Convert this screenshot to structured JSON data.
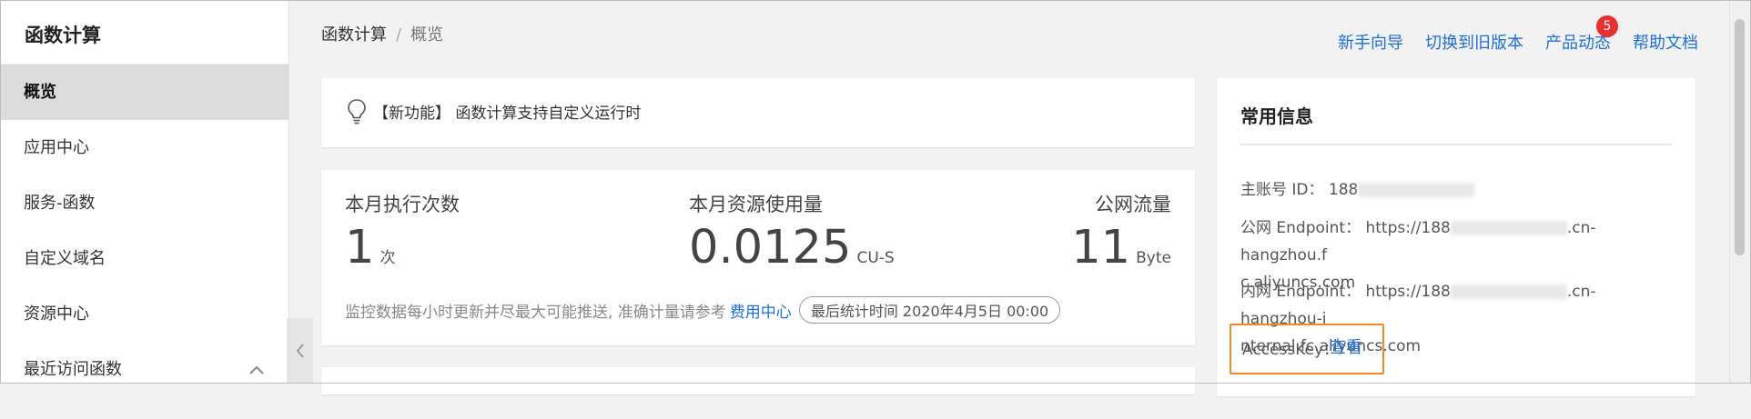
{
  "app_title": "函数计算",
  "sidebar": {
    "items": [
      {
        "label": "概览"
      },
      {
        "label": "应用中心"
      },
      {
        "label": "服务-函数"
      },
      {
        "label": "自定义域名"
      },
      {
        "label": "资源中心"
      },
      {
        "label": "最近访问函数"
      }
    ],
    "collapse_glyph": "‹",
    "expand_glyph": "︿"
  },
  "breadcrumb": {
    "root": "函数计算",
    "separator": "/",
    "current": "概览"
  },
  "header_links": {
    "guide": "新手向导",
    "switch_old": "切换到旧版本",
    "updates": "产品动态",
    "updates_badge": "5",
    "help": "帮助文档"
  },
  "notice": {
    "text": "【新功能】 函数计算支持自定义运行时"
  },
  "stats": {
    "executions": {
      "label": "本月执行次数",
      "value": "1",
      "unit": "次"
    },
    "resource": {
      "label": "本月资源使用量",
      "value": "0.0125",
      "unit": "CU-S"
    },
    "traffic": {
      "label": "公网流量",
      "value": "11",
      "unit": "Byte"
    },
    "footnote": "监控数据每小时更新并尽最大可能推送, 准确计量请参考",
    "billing_link": "费用中心",
    "last_updated": "最后统计时间  2020年4月5日 00:00"
  },
  "info": {
    "title": "常用信息",
    "account_label": "主账号 ID：",
    "account_value": "188",
    "public_label": "公网 Endpoint：",
    "public_prefix": "https://188",
    "public_suffix": ".cn-hangzhou.f",
    "public_line2": "c.aliyuncs.com",
    "internal_label": "内网 Endpoint：",
    "internal_prefix": "https://188",
    "internal_suffix": ".cn-hangzhou-i",
    "internal_line2": "nternal.fc.aliyuncs.com",
    "accesskey_label": "AccessKey：",
    "accesskey_link": "查看"
  },
  "colors": {
    "link": "#1e6fd9",
    "badge": "#e8312f",
    "highlight": "#f08a24"
  }
}
